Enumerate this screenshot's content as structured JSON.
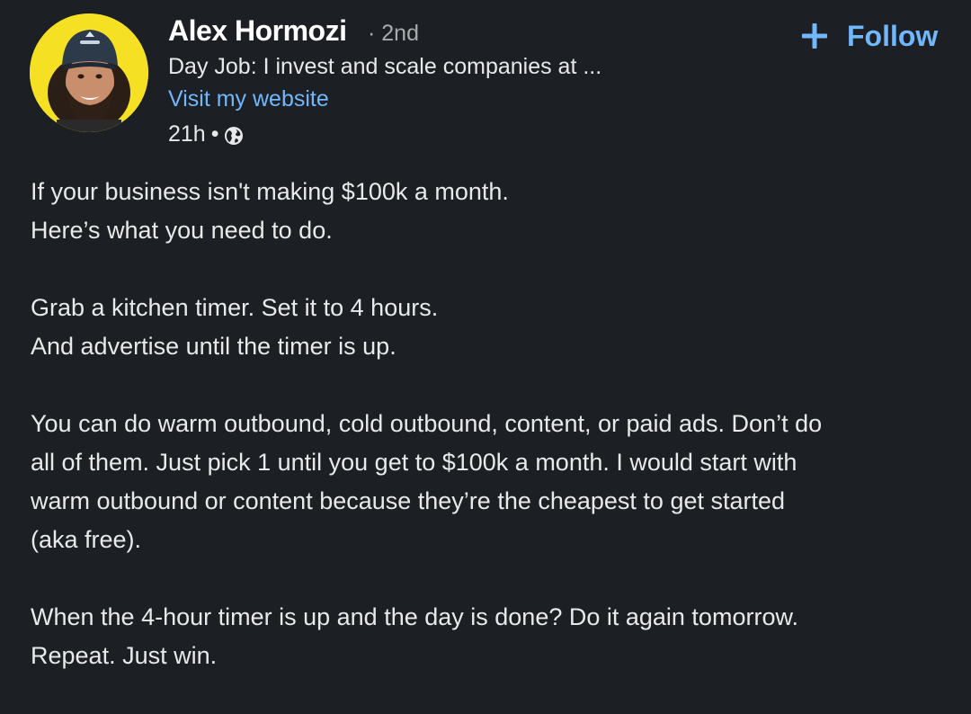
{
  "author": {
    "name": "Alex Hormozi",
    "degree": "· 2nd",
    "headline": "Day Job: I invest and scale companies at ...",
    "website_label": "Visit my website",
    "time": "21h",
    "dot": "•",
    "visibility_icon": "globe-icon",
    "avatar_icon": "profile-photo"
  },
  "follow": {
    "icon": "plus-icon",
    "label": "Follow"
  },
  "colors": {
    "background": "#1c1f23",
    "accent": "#71b7fb",
    "avatar_bg": "#f6e023"
  },
  "post": {
    "paragraphs": [
      {
        "lines": [
          "If your business isn't making $100k a month.",
          "Here’s what you need to do."
        ]
      },
      {
        "lines": [
          "Grab a kitchen timer. Set it to 4 hours.",
          "And advertise until the timer is up."
        ]
      },
      {
        "lines": [
          "You can do warm outbound, cold outbound, content, or paid ads. Don’t do",
          "all of them. Just pick 1 until you get to $100k a month. I would start with",
          "warm outbound or content because they’re the cheapest to get started",
          "(aka free)."
        ]
      },
      {
        "lines": [
          "When the 4-hour timer is up and the day is done? Do it again tomorrow.",
          "Repeat. Just win."
        ]
      }
    ]
  }
}
